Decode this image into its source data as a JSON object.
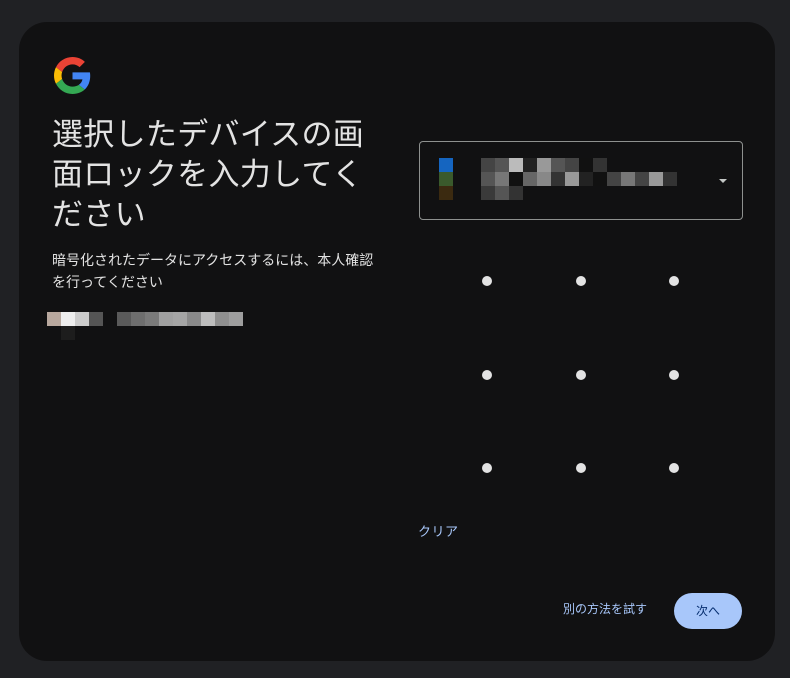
{
  "logo": {
    "icon": "google-g-icon"
  },
  "heading": {
    "title": "選択したデバイスの画面ロックを入力してください",
    "subtitle": "暗号化されたデータにアクセスするには、本人確認を行ってください"
  },
  "account": {
    "avatar_mosaic": [
      "#b8a89e",
      "#eeeeee",
      "#cccccc",
      "#555555"
    ],
    "email_mosaic": [
      "#5a5a5a",
      "#6e6e6e",
      "#7a7a7a",
      "#a0a0a0",
      "#a5a5a5",
      "#8a8a8a",
      "#bdbdbd",
      "#8f8f8f",
      "#9e9e9e"
    ]
  },
  "device_select": {
    "icon": "phone-icon",
    "icon_colors": [
      "#1565c0",
      "#3a5a2c",
      "#3b2a10"
    ],
    "name_mosaic_row1": [
      "#444444",
      "#555555",
      "#bbbbbb",
      "#222222",
      "#999999",
      "#555555",
      "#444444",
      "#111111",
      "#333333"
    ],
    "name_mosaic_row2": [
      "#555555",
      "#777777",
      "#111111",
      "#666666",
      "#888888",
      "#333333",
      "#999999",
      "#222222",
      "#111111",
      "#444444",
      "#777777",
      "#444444",
      "#999999",
      "#333333"
    ],
    "name_mosaic_row3": [
      "#3a3a3a",
      "#555555",
      "#333333"
    ],
    "arrow_icon": "caret-down-icon"
  },
  "pattern": {
    "rows": 3,
    "cols": 3
  },
  "actions": {
    "clear_label": "クリア",
    "try_another_label": "別の方法を試す",
    "next_label": "次へ"
  },
  "colors": {
    "page_bg": "#202124",
    "card_bg": "#111112",
    "text": "#e3e3e3",
    "accent": "#a8c7fa",
    "button_text": "#062e6f"
  }
}
